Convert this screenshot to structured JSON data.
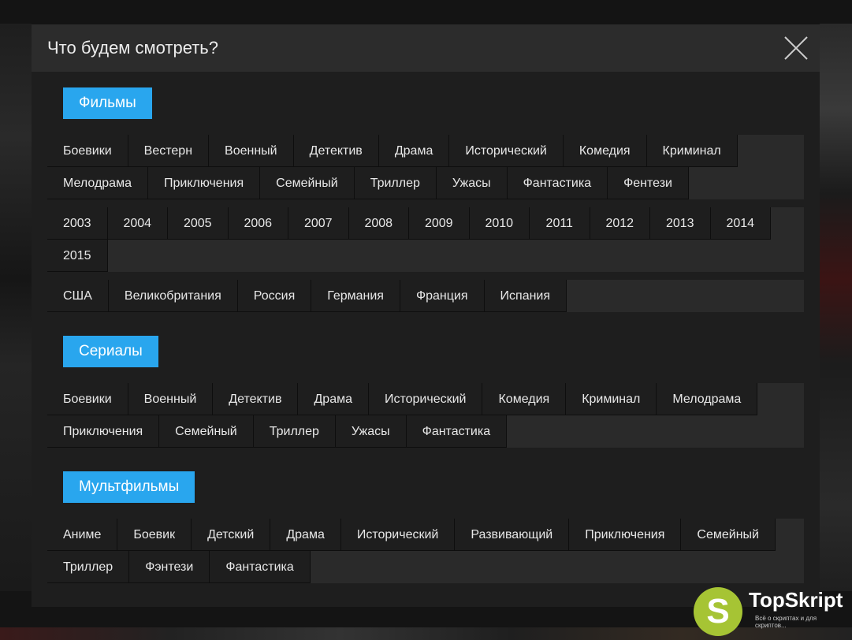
{
  "modal": {
    "title": "Что будем смотреть?"
  },
  "films": {
    "label": "Фильмы",
    "genres": [
      "Боевики",
      "Вестерн",
      "Военный",
      "Детектив",
      "Драма",
      "Исторический",
      "Комедия",
      "Криминал",
      "Мелодрама",
      "Приключения",
      "Семейный",
      "Триллер",
      "Ужасы",
      "Фантастика",
      "Фентези"
    ],
    "years": [
      "2003",
      "2004",
      "2005",
      "2006",
      "2007",
      "2008",
      "2009",
      "2010",
      "2011",
      "2012",
      "2013",
      "2014",
      "2015"
    ],
    "countries": [
      "США",
      "Великобритания",
      "Россия",
      "Германия",
      "Франция",
      "Испания"
    ]
  },
  "series": {
    "label": "Сериалы",
    "genres": [
      "Боевики",
      "Военный",
      "Детектив",
      "Драма",
      "Исторический",
      "Комедия",
      "Криминал",
      "Мелодрама",
      "Приключения",
      "Семейный",
      "Триллер",
      "Ужасы",
      "Фантастика"
    ]
  },
  "cartoons": {
    "label": "Мультфильмы",
    "genres": [
      "Аниме",
      "Боевик",
      "Детский",
      "Драма",
      "Исторический",
      "Развивающий",
      "Приключения",
      "Семейный",
      "Триллер",
      "Фэнтези",
      "Фантастика"
    ]
  },
  "watermark": {
    "letter": "S",
    "name": "TopSkript",
    "tagline": "Всё о скриптах и для скриптов..."
  },
  "colors": {
    "accent": "#29a6ee",
    "logo": "#a6c434"
  }
}
